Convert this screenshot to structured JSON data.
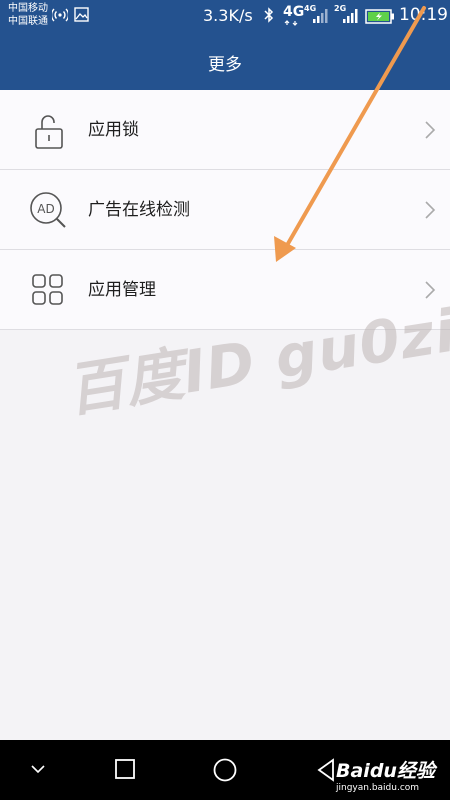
{
  "status_bar": {
    "carrier_1": "中国移动",
    "carrier_2": "中国联通",
    "net_speed": "3.3K/s",
    "network_4g": "4G",
    "signal_1_label": "4G",
    "signal_2_label": "2G",
    "time": "10:19"
  },
  "header": {
    "title": "更多"
  },
  "menu": {
    "items": [
      {
        "label": "应用锁",
        "icon": "lock-icon"
      },
      {
        "label": "广告在线检测",
        "icon": "ad-search-icon"
      },
      {
        "label": "应用管理",
        "icon": "grid-apps-icon"
      }
    ]
  },
  "watermark": {
    "text": "百度ID gu0zi"
  },
  "nav_bar": {
    "baidu_logo": "Baidu经验",
    "baidu_site": "jingyan.baidu.com"
  },
  "colors": {
    "header_bg": "#24528f",
    "arrow": "#ef9a4f",
    "background": "#f4f3f6"
  }
}
